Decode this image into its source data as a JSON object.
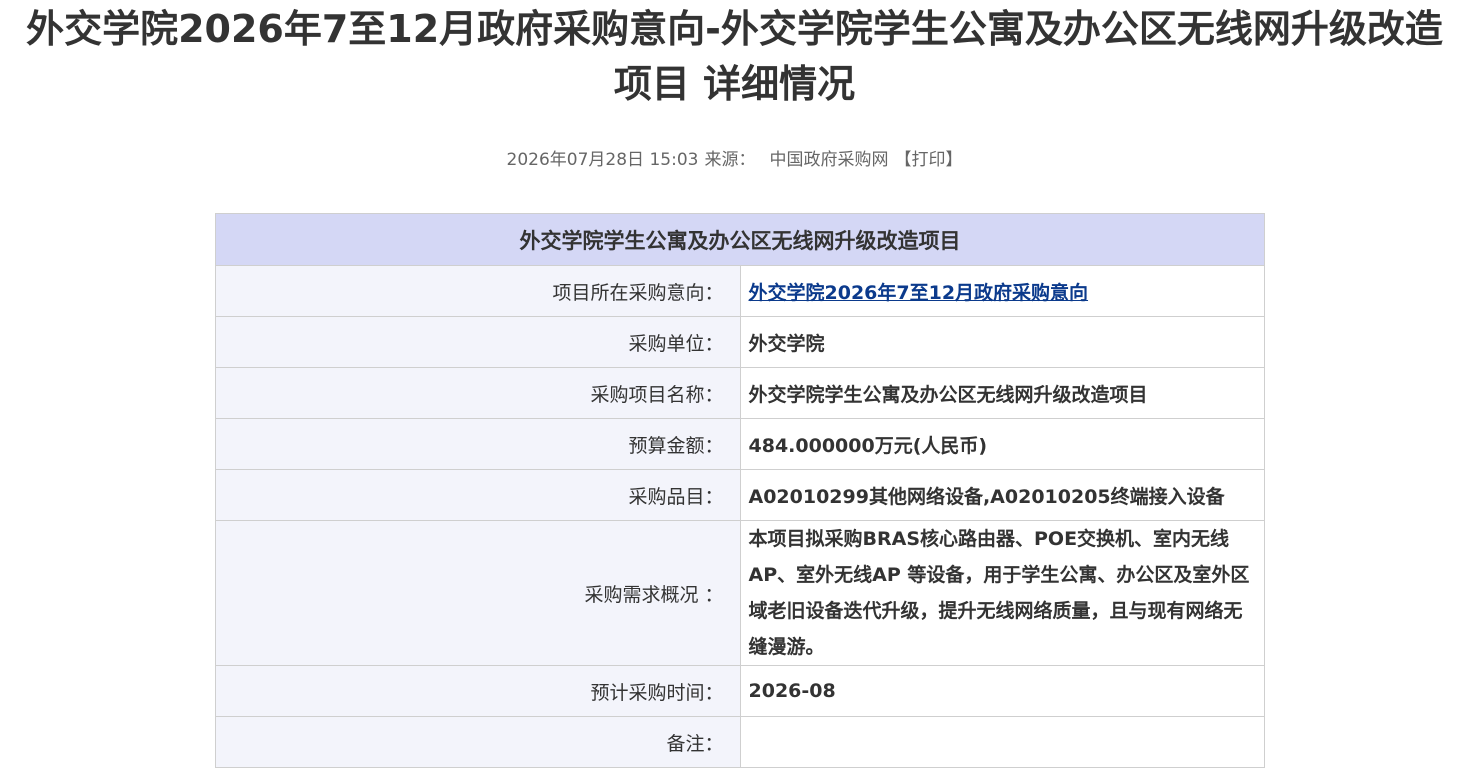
{
  "page": {
    "title_line1": "外交学院2026年7至12月政府采购意向-外交学院学生公寓及办公区无线网升级改造",
    "title_line2": "项目 详细情况"
  },
  "meta": {
    "datetime": "2026年07月28日 15:03",
    "source_label": "来源：",
    "source_value": "中国政府采购网",
    "print_label": "【打印】"
  },
  "table": {
    "header": "外交学院学生公寓及办公区无线网升级改造项目",
    "rows": [
      {
        "label": "项目所在采购意向：",
        "value": "外交学院2026年7至12月政府采购意向"
      },
      {
        "label": "采购单位：",
        "value": "外交学院"
      },
      {
        "label": "采购项目名称：",
        "value": "外交学院学生公寓及办公区无线网升级改造项目"
      },
      {
        "label": "预算金额：",
        "value": "484.000000万元(人民币)"
      },
      {
        "label": "采购品目：",
        "value": "A02010299其他网络设备,A02010205终端接入设备"
      },
      {
        "label": "采购需求概况 ：",
        "value": "本项目拟采购BRAS核心路由器、POE交换机、室内无线AP、室外无线AP 等设备，用于学生公寓、办公区及室外区域老旧设备迭代升级，提升无线网络质量，且与现有网络无缝漫游。"
      },
      {
        "label": "预计采购时间：",
        "value": "2026-08"
      },
      {
        "label": "备注：",
        "value": ""
      }
    ]
  }
}
